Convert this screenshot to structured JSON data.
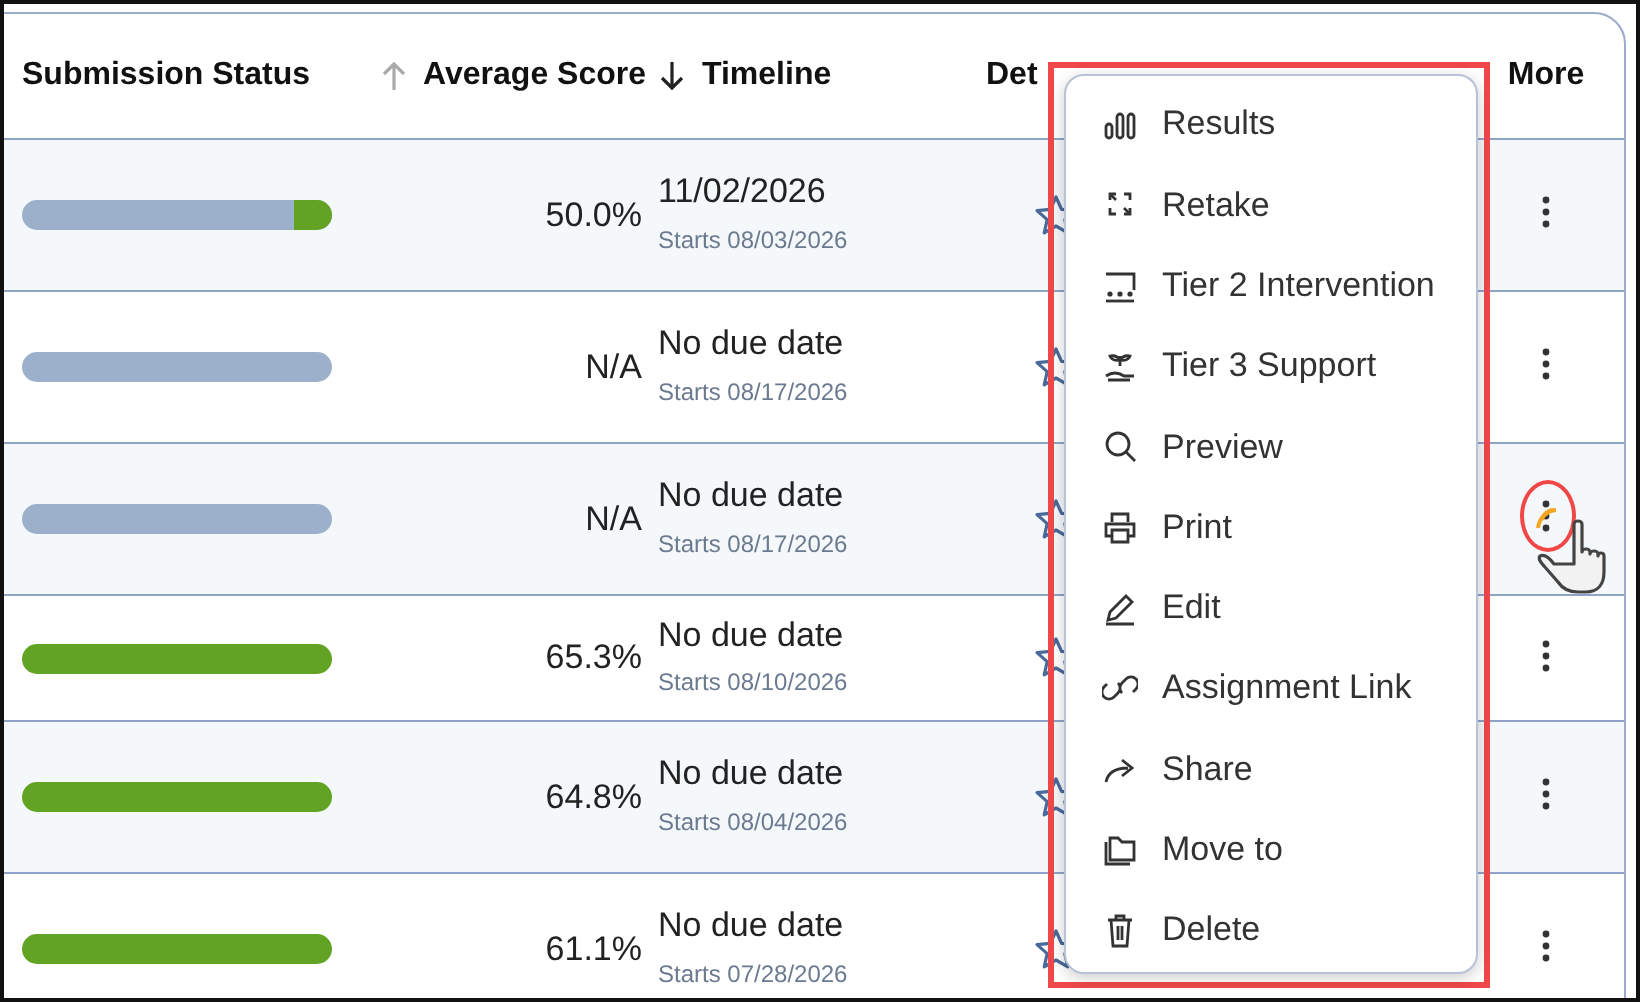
{
  "columns": [
    {
      "label": "Submission Status"
    },
    {
      "label": "Average Score",
      "sort_ascending": true,
      "sort_active": false
    },
    {
      "label": "Timeline",
      "sort_ascending": false,
      "sort_active": true
    },
    {
      "label": "Det"
    },
    {
      "label": "More"
    }
  ],
  "rows": [
    {
      "level": 0.12,
      "score": "50.0%",
      "due": "11/02/2026",
      "starts": "Starts 08/03/2026",
      "starred": false
    },
    {
      "level": 0,
      "score": "N/A",
      "due": "No due date",
      "starts": "Starts 08/17/2026",
      "starred": false
    },
    {
      "level": 0,
      "score": "N/A",
      "due": "No due date",
      "starts": "Starts 08/17/2026",
      "starred": false,
      "menu_open": true
    },
    {
      "level": 1,
      "score": "65.3%",
      "due": "No due date",
      "starts": "Starts 08/10/2026",
      "starred": false
    },
    {
      "level": 1,
      "score": "64.8%",
      "due": "No due date",
      "starts": "Starts 08/04/2026",
      "starred": false
    },
    {
      "level": 1,
      "score": "61.1%",
      "due": "No due date",
      "starts": "Starts 07/28/2026",
      "starred": false
    }
  ],
  "context_menu": {
    "items": [
      {
        "label": "Results"
      },
      {
        "label": "Retake"
      },
      {
        "label": "Tier 2 Intervention"
      },
      {
        "label": "Tier 3 Support"
      },
      {
        "label": "Preview"
      },
      {
        "label": "Print"
      },
      {
        "label": "Edit"
      },
      {
        "label": "Assignment Link"
      },
      {
        "label": "Share"
      },
      {
        "label": "Move to"
      },
      {
        "label": "Delete"
      }
    ]
  }
}
